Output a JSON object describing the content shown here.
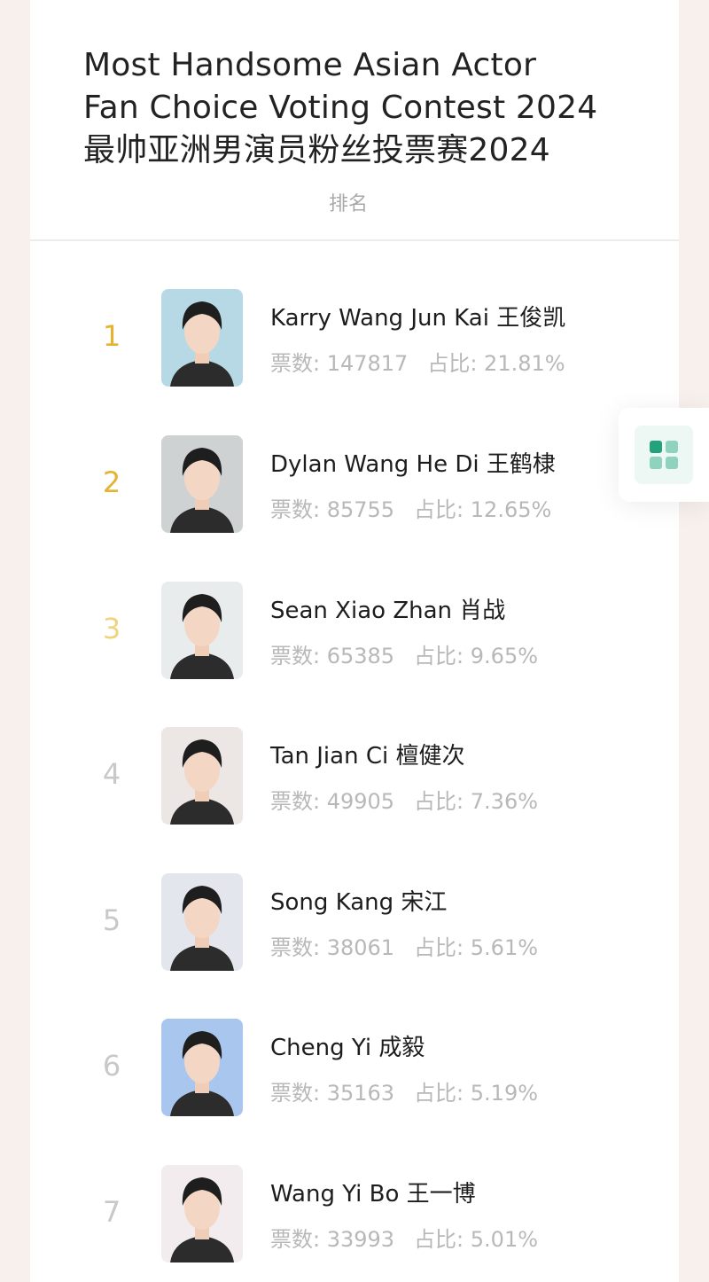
{
  "header": {
    "title_lines": [
      "Most Handsome Asian Actor",
      "Fan Choice Voting Contest 2024",
      "最帅亚洲男演员粉丝投票赛2024"
    ],
    "subtitle": "排名"
  },
  "labels": {
    "votes_prefix": "票数: ",
    "share_prefix": "占比: "
  },
  "colors": {
    "rank_gold": "#e4b330",
    "rank_gold_light": "#efd37f",
    "rank_gray": "#c8c8c8",
    "accent_green": "#2bb38a"
  },
  "ranking": [
    {
      "rank": "1",
      "name": "Karry Wang Jun Kai 王俊凯",
      "votes_text": "票数: 147817",
      "share_text": "占比: 21.81%",
      "votes": 147817,
      "share_percent": 21.81,
      "avatar_bg": "#b7d9e5"
    },
    {
      "rank": "2",
      "name": "Dylan Wang He Di 王鹤棣",
      "votes_text": "票数: 85755",
      "share_text": "占比: 12.65%",
      "votes": 85755,
      "share_percent": 12.65,
      "avatar_bg": "#cfd2d2"
    },
    {
      "rank": "3",
      "name": "Sean Xiao Zhan 肖战",
      "votes_text": "票数: 65385",
      "share_text": "占比: 9.65%",
      "votes": 65385,
      "share_percent": 9.65,
      "avatar_bg": "#e9ecec"
    },
    {
      "rank": "4",
      "name": "Tan Jian Ci 檀健次",
      "votes_text": "票数: 49905",
      "share_text": "占比: 7.36%",
      "votes": 49905,
      "share_percent": 7.36,
      "avatar_bg": "#ece6e4"
    },
    {
      "rank": "5",
      "name": "Song Kang 宋江",
      "votes_text": "票数: 38061",
      "share_text": "占比: 5.61%",
      "votes": 38061,
      "share_percent": 5.61,
      "avatar_bg": "#e4e6ee"
    },
    {
      "rank": "6",
      "name": "Cheng Yi 成毅",
      "votes_text": "票数: 35163",
      "share_text": "占比: 5.19%",
      "votes": 35163,
      "share_percent": 5.19,
      "avatar_bg": "#a8c6ee"
    },
    {
      "rank": "7",
      "name": "Wang Yi Bo 王一博",
      "votes_text": "票数: 33993",
      "share_text": "占比: 5.01%",
      "votes": 33993,
      "share_percent": 5.01,
      "avatar_bg": "#f2ecee"
    }
  ],
  "floating_button": {
    "icon": "grid-apps-icon"
  }
}
